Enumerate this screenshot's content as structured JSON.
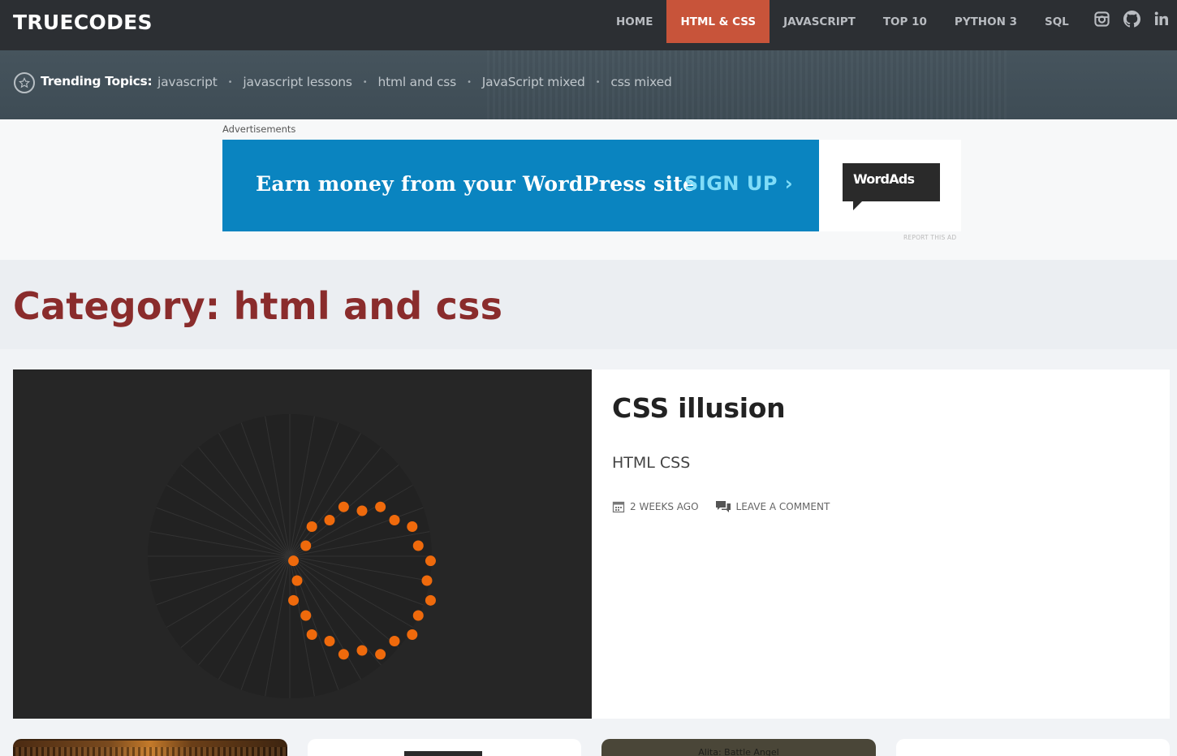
{
  "header": {
    "logo": "TRUECODES",
    "nav": [
      {
        "label": "HOME"
      },
      {
        "label": "HTML & CSS",
        "active": true
      },
      {
        "label": "JAVASCRIPT"
      },
      {
        "label": "TOP 10"
      },
      {
        "label": "PYTHON 3"
      },
      {
        "label": "SQL"
      }
    ],
    "social_icons": [
      "instagram-icon",
      "github-icon",
      "linkedin-icon"
    ]
  },
  "trending": {
    "label": "Trending Topics:",
    "links": [
      "javascript",
      "javascript lessons",
      "html and css",
      "JavaScript mixed",
      "css mixed"
    ]
  },
  "ad": {
    "caption": "Advertisements",
    "headline": "Earn money from your WordPress site",
    "cta": "SIGN UP ›",
    "brand": "WordAds",
    "report": "REPORT THIS AD"
  },
  "category": {
    "title": "Category: html and css"
  },
  "featured_post": {
    "title": "CSS illusion",
    "excerpt": "HTML CSS",
    "date": "2 WEEKS AGO",
    "comments": "LEAVE A COMMENT"
  },
  "cards": [
    {
      "label": ""
    },
    {
      "label": ""
    },
    {
      "label": "Alita: Battle Angel"
    },
    {
      "label": ""
    }
  ],
  "colors": {
    "accent": "#c8543a",
    "category_title": "#8a2c2c",
    "ad_blue": "#0a84c0",
    "illusion_dot": "#ef6a0c"
  }
}
